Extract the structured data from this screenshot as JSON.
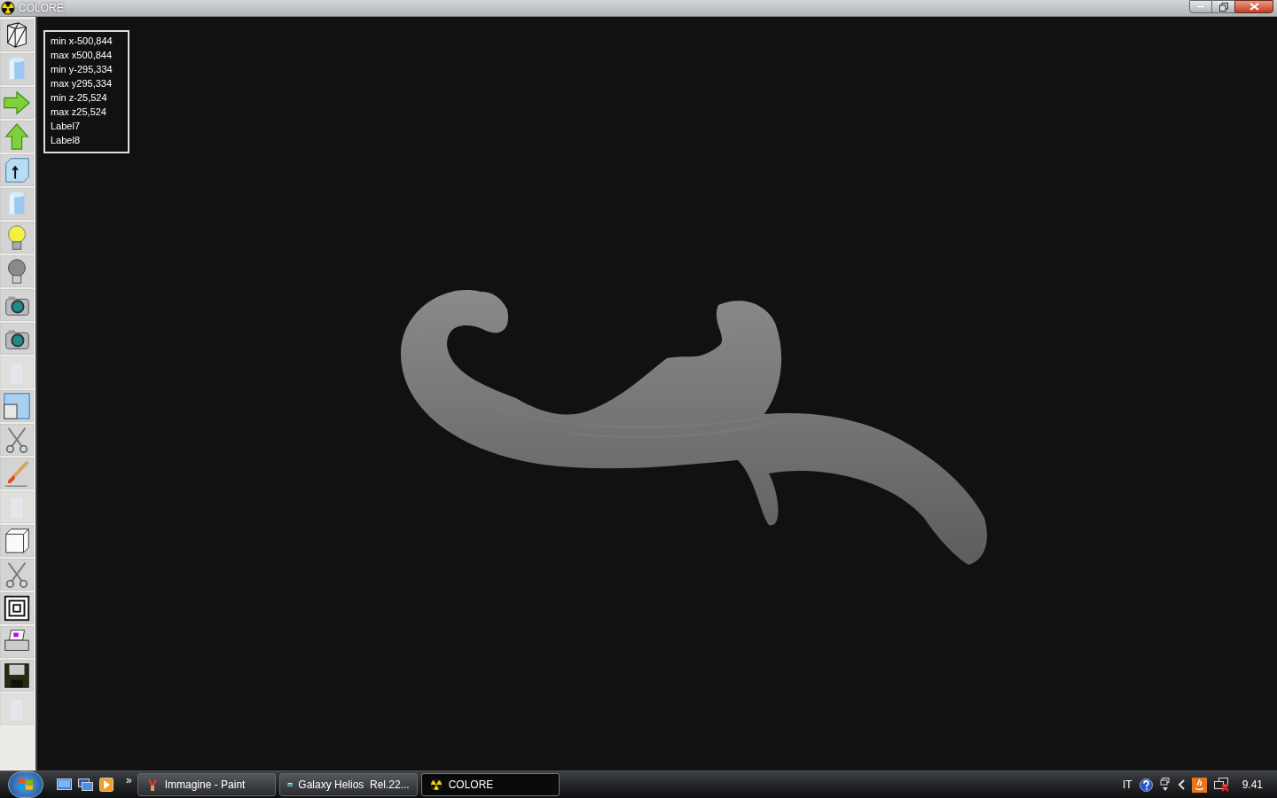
{
  "window": {
    "title": "COLORE"
  },
  "toolbar": [
    {
      "kind": "wireframe",
      "disabled": false
    },
    {
      "kind": "cylinder",
      "disabled": false
    },
    {
      "kind": "arrow-right",
      "disabled": false
    },
    {
      "kind": "arrow-up",
      "disabled": false
    },
    {
      "kind": "cube-arrow",
      "disabled": false
    },
    {
      "kind": "cylinder",
      "disabled": false
    },
    {
      "kind": "bulb-on",
      "disabled": false
    },
    {
      "kind": "bulb-off",
      "disabled": false
    },
    {
      "kind": "camera",
      "disabled": false
    },
    {
      "kind": "camera",
      "disabled": false
    },
    {
      "kind": "glass",
      "disabled": true
    },
    {
      "kind": "window",
      "disabled": false
    },
    {
      "kind": "scissors",
      "disabled": false
    },
    {
      "kind": "brush",
      "disabled": false
    },
    {
      "kind": "glass",
      "disabled": true
    },
    {
      "kind": "cube",
      "disabled": false
    },
    {
      "kind": "scissors",
      "disabled": false
    },
    {
      "kind": "squares",
      "disabled": false
    },
    {
      "kind": "printer",
      "disabled": false
    },
    {
      "kind": "floppy",
      "disabled": false
    },
    {
      "kind": "glass",
      "disabled": true
    }
  ],
  "info_panel": [
    "min x-500,844",
    "max x500,844",
    "min y-295,334",
    "max y295,334",
    "min z-25,524",
    "max z25,524",
    "Label7",
    "Label8"
  ],
  "taskbar": {
    "buttons": [
      {
        "label": "Immagine - Paint",
        "kind": "paint",
        "selected": false
      },
      {
        "label": "Galaxy Helios  Rel.22...",
        "kind": "galaxy",
        "selected": false
      },
      {
        "label": "COLORE",
        "kind": "colore",
        "selected": true
      }
    ],
    "overflow": "»",
    "language": "IT",
    "clock": "9.41"
  }
}
